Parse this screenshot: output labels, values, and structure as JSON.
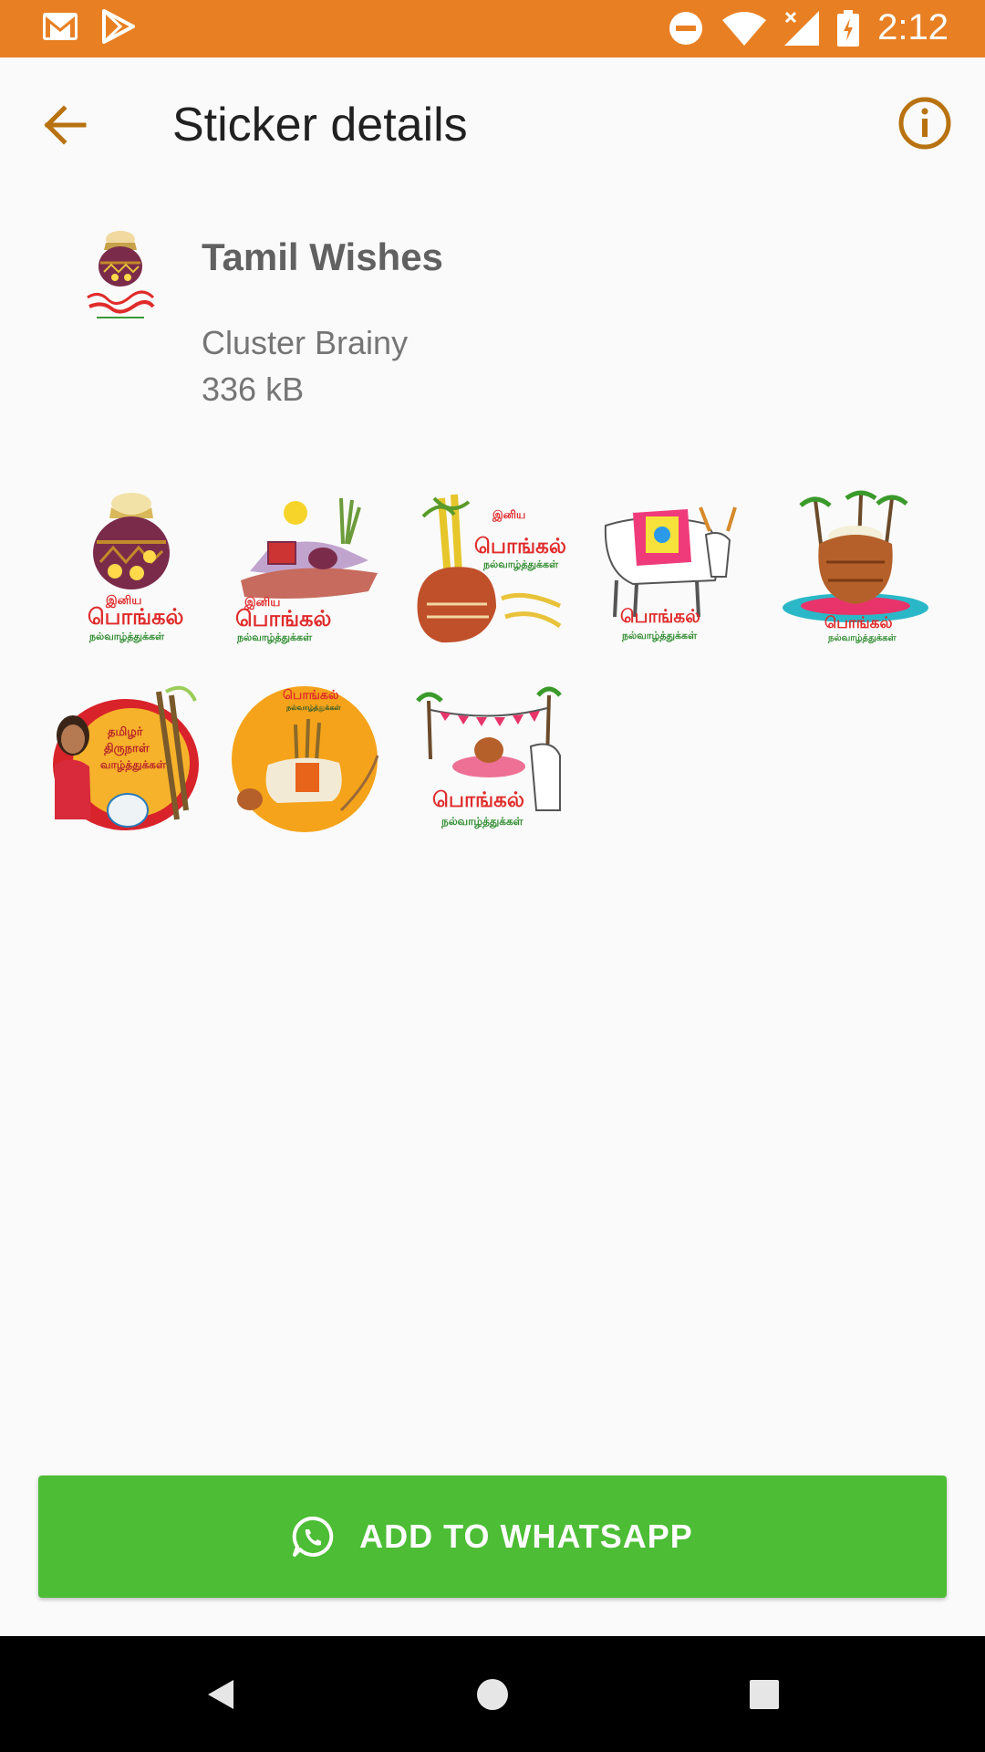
{
  "status_bar": {
    "time": "2:12",
    "icons": [
      "gmail-icon",
      "play-store-icon",
      "do-not-disturb-icon",
      "wifi-icon",
      "signal-icon",
      "battery-icon"
    ]
  },
  "app_bar": {
    "title": "Sticker details",
    "back_icon": "arrow-back-icon",
    "info_icon": "info-icon",
    "accent_color": "#b8720f"
  },
  "pack": {
    "name": "Tamil Wishes",
    "publisher": "Cluster Brainy",
    "size": "336 kB"
  },
  "stickers": [
    {
      "id": "sticker-1",
      "title": "இனிய",
      "caption": "பொங்கல்",
      "subcaption": "நல்வாழ்த்துக்கள்"
    },
    {
      "id": "sticker-2",
      "title": "இனிய",
      "caption": "பொங்கல்",
      "subcaption": "நல்வாழ்த்துக்கள்"
    },
    {
      "id": "sticker-3",
      "title": "இனிய",
      "caption": "பொங்கல்",
      "subcaption": "நல்வாழ்த்துக்கள்"
    },
    {
      "id": "sticker-4",
      "title": "",
      "caption": "பொங்கல்",
      "subcaption": "நல்வாழ்த்துக்கள்"
    },
    {
      "id": "sticker-5",
      "title": "",
      "caption": "பொங்கல்",
      "subcaption": "நல்வாழ்த்துக்கள்"
    },
    {
      "id": "sticker-6",
      "title": "தமிழர்",
      "caption": "திருநாள்",
      "subcaption": "வாழ்த்துக்கள்"
    },
    {
      "id": "sticker-7",
      "title": "",
      "caption": "பொங்கல்",
      "subcaption": "நல்வாழ்த்துக்கள்"
    },
    {
      "id": "sticker-8",
      "title": "",
      "caption": "பொங்கல்",
      "subcaption": "நல்வாழ்த்துக்கள்"
    }
  ],
  "add_button": {
    "label": "ADD TO WHATSAPP",
    "icon": "whatsapp-icon",
    "color": "#4cbd35"
  },
  "nav_bar": {
    "items": [
      "back-nav-icon",
      "home-nav-icon",
      "recents-nav-icon"
    ]
  },
  "colors": {
    "status_bar": "#e88023",
    "background": "#fafafa"
  }
}
